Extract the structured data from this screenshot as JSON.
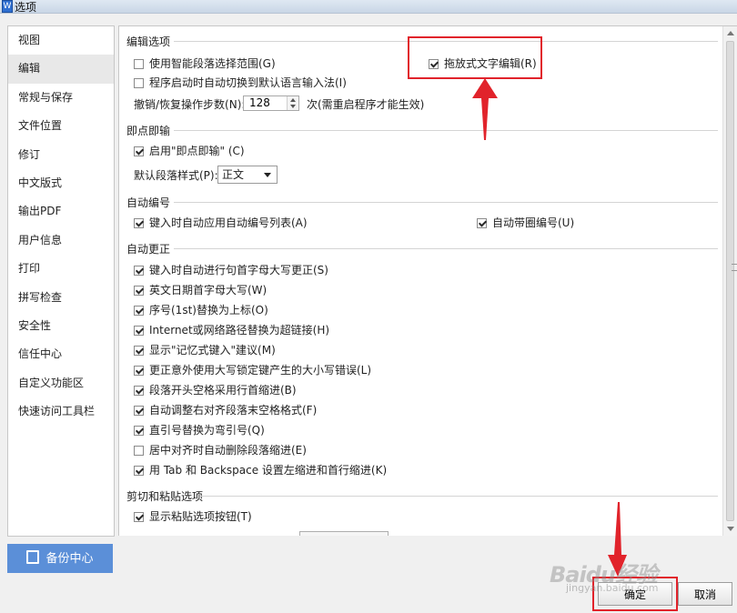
{
  "window": {
    "title": "选项",
    "icon": "wps-writer-icon"
  },
  "sidebar": {
    "items": [
      {
        "label": "视图"
      },
      {
        "label": "编辑"
      },
      {
        "label": "常规与保存"
      },
      {
        "label": "文件位置"
      },
      {
        "label": "修订"
      },
      {
        "label": "中文版式"
      },
      {
        "label": "输出PDF"
      },
      {
        "label": "用户信息"
      },
      {
        "label": "打印"
      },
      {
        "label": "拼写检查"
      },
      {
        "label": "安全性"
      },
      {
        "label": "信任中心"
      },
      {
        "label": "自定义功能区"
      },
      {
        "label": "快速访问工具栏"
      }
    ],
    "active": "编辑",
    "backup_label": "备份中心"
  },
  "sections": {
    "edit": {
      "title": "编辑选项",
      "smart_select": {
        "label": "使用智能段落选择范围(G)",
        "checked": false
      },
      "auto_ime": {
        "label": "程序启动时自动切换到默认语言输入法(I)",
        "checked": false
      },
      "drag_drop": {
        "label": "拖放式文字编辑(R)",
        "checked": true
      },
      "undo_label": "撤销/恢复操作步数(N):",
      "undo_value": "128",
      "undo_note": "次(需重启程序才能生效)"
    },
    "click_type": {
      "title": "即点即输",
      "enable": {
        "label": "启用\"即点即输\" (C)",
        "checked": true
      },
      "style_label": "默认段落样式(P):",
      "style_value": "正文"
    },
    "auto_number": {
      "title": "自动编号",
      "auto_list": {
        "label": "键入时自动应用自动编号列表(A)",
        "checked": true
      },
      "auto_circle": {
        "label": "自动带圈编号(U)",
        "checked": true
      }
    },
    "autocorrect": {
      "title": "自动更正",
      "items": [
        {
          "label": "键入时自动进行句首字母大写更正(S)",
          "checked": true
        },
        {
          "label": "英文日期首字母大写(W)",
          "checked": true
        },
        {
          "label": "序号(1st)替换为上标(O)",
          "checked": true
        },
        {
          "label": "Internet或网络路径替换为超链接(H)",
          "checked": true
        },
        {
          "label": "显示\"记忆式键入\"建议(M)",
          "checked": true
        },
        {
          "label": "更正意外使用大写锁定键产生的大小写错误(L)",
          "checked": true
        },
        {
          "label": "段落开头空格采用行首缩进(B)",
          "checked": true
        },
        {
          "label": "自动调整右对齐段落末空格格式(F)",
          "checked": true
        },
        {
          "label": "直引号替换为弯引号(Q)",
          "checked": true
        },
        {
          "label": "居中对齐时自动删除段落缩进(E)",
          "checked": false
        },
        {
          "label": "用 Tab 和 Backspace 设置左缩进和首行缩进(K)",
          "checked": true
        }
      ]
    },
    "paste": {
      "title": "剪切和粘贴选项",
      "show_paste_btn": {
        "label": "显示粘贴选项按钮(T)",
        "checked": true
      }
    }
  },
  "footer": {
    "ok_label": "确定",
    "cancel_label": "取消"
  },
  "watermark": {
    "text": "Baidu经验",
    "sub": "jingyan.baidu.com"
  },
  "colors": {
    "highlight": "#e1232b",
    "backup_button": "#5b8fd8"
  }
}
